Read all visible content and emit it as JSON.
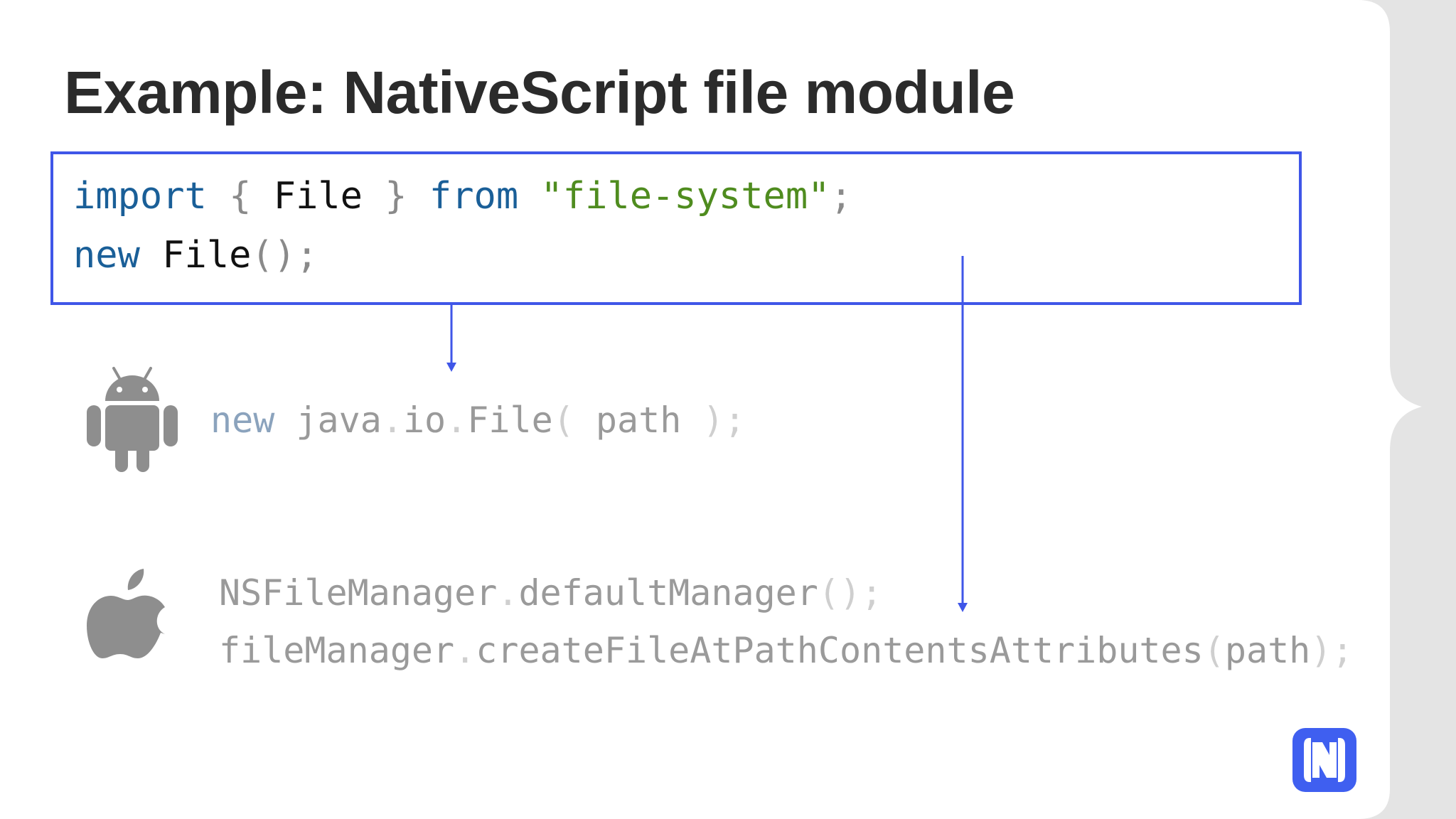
{
  "slide": {
    "title": "Example: NativeScript file module"
  },
  "code_main": {
    "line1": [
      {
        "text": "import",
        "kind": "kw"
      },
      {
        "text": " { ",
        "kind": "punc"
      },
      {
        "text": "File",
        "kind": "id"
      },
      {
        "text": " } ",
        "kind": "punc"
      },
      {
        "text": "from",
        "kind": "kw"
      },
      {
        "text": " ",
        "kind": "punc"
      },
      {
        "text": "\"file-system\"",
        "kind": "str"
      },
      {
        "text": ";",
        "kind": "punc"
      }
    ],
    "line2": [
      {
        "text": "new",
        "kind": "kw"
      },
      {
        "text": " ",
        "kind": "punc"
      },
      {
        "text": "File",
        "kind": "id"
      },
      {
        "text": "();",
        "kind": "punc"
      }
    ]
  },
  "android": {
    "icon": "android-icon",
    "line": [
      {
        "text": "new",
        "kind": "faded-kw"
      },
      {
        "text": " java",
        "kind": "faded-id"
      },
      {
        "text": ".",
        "kind": "faded-punc"
      },
      {
        "text": "io",
        "kind": "faded-id"
      },
      {
        "text": ".",
        "kind": "faded-punc"
      },
      {
        "text": "File",
        "kind": "faded-id"
      },
      {
        "text": "( ",
        "kind": "faded-punc"
      },
      {
        "text": "path",
        "kind": "faded-id"
      },
      {
        "text": " );",
        "kind": "faded-punc"
      }
    ]
  },
  "ios": {
    "icon": "apple-icon",
    "line1": [
      {
        "text": "NSFileManager",
        "kind": "faded-id"
      },
      {
        "text": ".",
        "kind": "faded-punc"
      },
      {
        "text": "defaultManager",
        "kind": "faded-id"
      },
      {
        "text": "();",
        "kind": "faded-punc"
      }
    ],
    "line2": [
      {
        "text": "fileManager",
        "kind": "faded-id"
      },
      {
        "text": ".",
        "kind": "faded-punc"
      },
      {
        "text": "createFileAtPathContentsAttributes",
        "kind": "faded-id"
      },
      {
        "text": "(",
        "kind": "faded-punc"
      },
      {
        "text": "path",
        "kind": "faded-id"
      },
      {
        "text": ");",
        "kind": "faded-punc"
      }
    ]
  },
  "colors": {
    "accent": "#3f56e8",
    "keyword": "#1a5f98",
    "string": "#4f8c1f",
    "title": "#2b2b2b",
    "icon_gray": "#8e8e8e"
  },
  "logo": {
    "icon": "nativescript-logo-icon"
  }
}
